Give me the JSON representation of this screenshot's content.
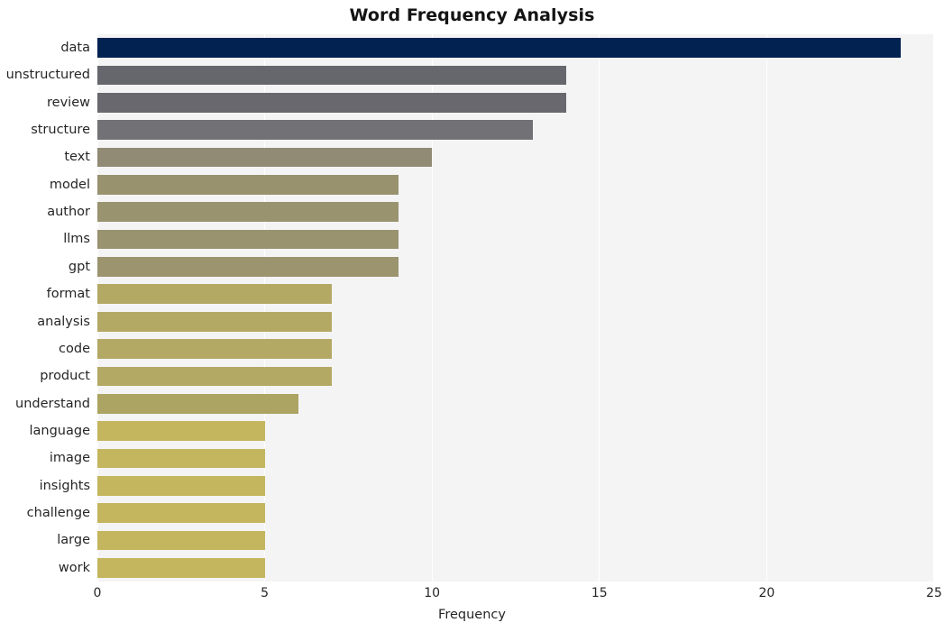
{
  "chart_data": {
    "type": "bar",
    "orientation": "horizontal",
    "title": "Word Frequency Analysis",
    "xlabel": "Frequency",
    "ylabel": "",
    "categories": [
      "data",
      "unstructured",
      "review",
      "structure",
      "text",
      "model",
      "author",
      "llms",
      "gpt",
      "format",
      "analysis",
      "code",
      "product",
      "understand",
      "language",
      "image",
      "insights",
      "challenge",
      "large",
      "work"
    ],
    "values": [
      24,
      14,
      14,
      13,
      10,
      9,
      9,
      9,
      9,
      7,
      7,
      7,
      7,
      6,
      5,
      5,
      5,
      5,
      5,
      5
    ],
    "xlim": [
      0,
      25
    ],
    "xticks": [
      0,
      5,
      10,
      15,
      20,
      25
    ],
    "xtick_labels": [
      "0",
      "5",
      "10",
      "15",
      "20",
      "25"
    ],
    "grid": "vertical-white",
    "legend": "none",
    "bar_colors": [
      "#022251",
      "#66666d",
      "#68686e",
      "#727276",
      "#918b75",
      "#99926f",
      "#9a9370",
      "#9a9370",
      "#9b946f",
      "#b3a965",
      "#b3a965",
      "#b3a965",
      "#b3a965",
      "#aca463",
      "#c3b65e",
      "#c3b65e",
      "#c3b65e",
      "#c3b65e",
      "#c3b65e",
      "#c3b65e"
    ],
    "plot_background": "#f4f4f5",
    "figure_background": "#ffffff"
  }
}
